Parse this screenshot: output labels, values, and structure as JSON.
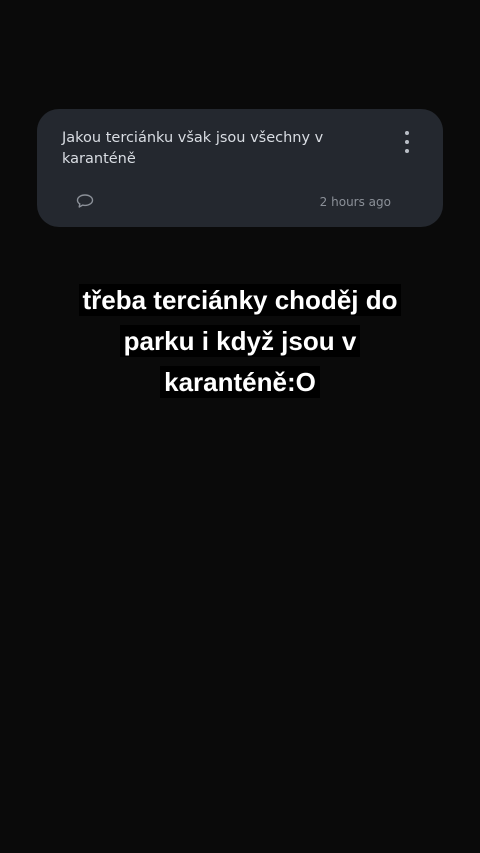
{
  "post": {
    "text": "Jakou terciánku však jsou všechny v karanténě",
    "timestamp": "2 hours ago",
    "icons": {
      "comment": "comment-bubble-icon",
      "more": "more-vertical-icon"
    }
  },
  "caption": {
    "lines": [
      "třeba terciánky choděj do",
      "parku i když jsou v",
      "karanténě:O"
    ]
  },
  "colors": {
    "background": "#0a0a0a",
    "card": "#24282f",
    "post_text": "#d9dde3",
    "timestamp": "#8b9098",
    "caption_text": "#ffffff",
    "caption_bg": "#000000"
  }
}
